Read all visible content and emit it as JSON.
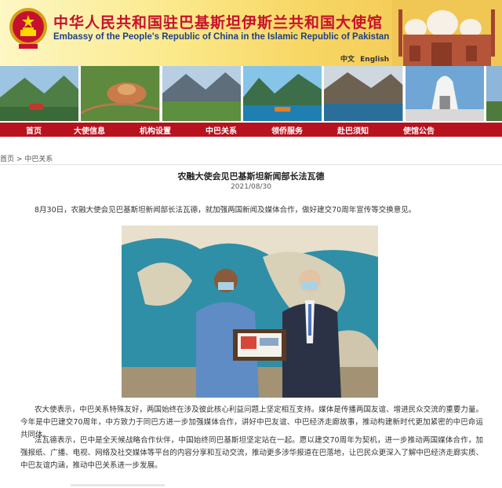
{
  "header": {
    "title_cn": "中华人民共和国驻巴基斯坦伊斯兰共和国大使馆",
    "title_en": "Embassy of the People's Republic of China in the Islamic Republic of Pakistan",
    "languages": [
      "中文",
      "English"
    ]
  },
  "nav": {
    "items": [
      "首页",
      "大使信息",
      "机构设置",
      "中巴关系",
      "领侨服务",
      "赴巴须知",
      "使馆公告"
    ]
  },
  "breadcrumb": {
    "home": "首页",
    "separator": ">",
    "current": "中巴关系"
  },
  "article": {
    "title": "农融大使会见巴基斯坦新闻部长法瓦德",
    "date": "2021/08/30",
    "paragraphs": [
      "8月30日，农融大使会见巴基斯坦新闻部长法瓦德，就加强两国新闻及媒体合作，做好建交70周年宣传等交换意见。",
      "农大使表示，中巴关系特殊友好，两国始终在涉及彼此核心利益问题上坚定相互支持。媒体是传播两国友谊、增进民众交流的重要力量。今年是中巴建交70周年，中方致力于同巴方进一步加强媒体合作，讲好中巴友谊、中巴经济走廊故事，推动构建新时代更加紧密的中巴命运共同体。",
      "法瓦德表示，巴中是全天候战略合作伙伴，中国始终同巴基斯坦坚定站在一起。愿以建交70周年为契机，进一步推动两国媒体合作，加强报纸、广播、电视、网络及社交媒体等平台的内容分享和互动交流，推动更多涉华报道在巴落地，让巴民众更深入了解中巴经济走廊实质、中巴友谊内涵，推动中巴关系进一步发展。"
    ]
  },
  "colors": {
    "nav_bg": "#b8121f",
    "title_red": "#c8102e",
    "title_blue": "#1d3f8a",
    "header_yellow": "#f7d765"
  },
  "icons": {
    "emblem": "national-emblem-icon"
  }
}
